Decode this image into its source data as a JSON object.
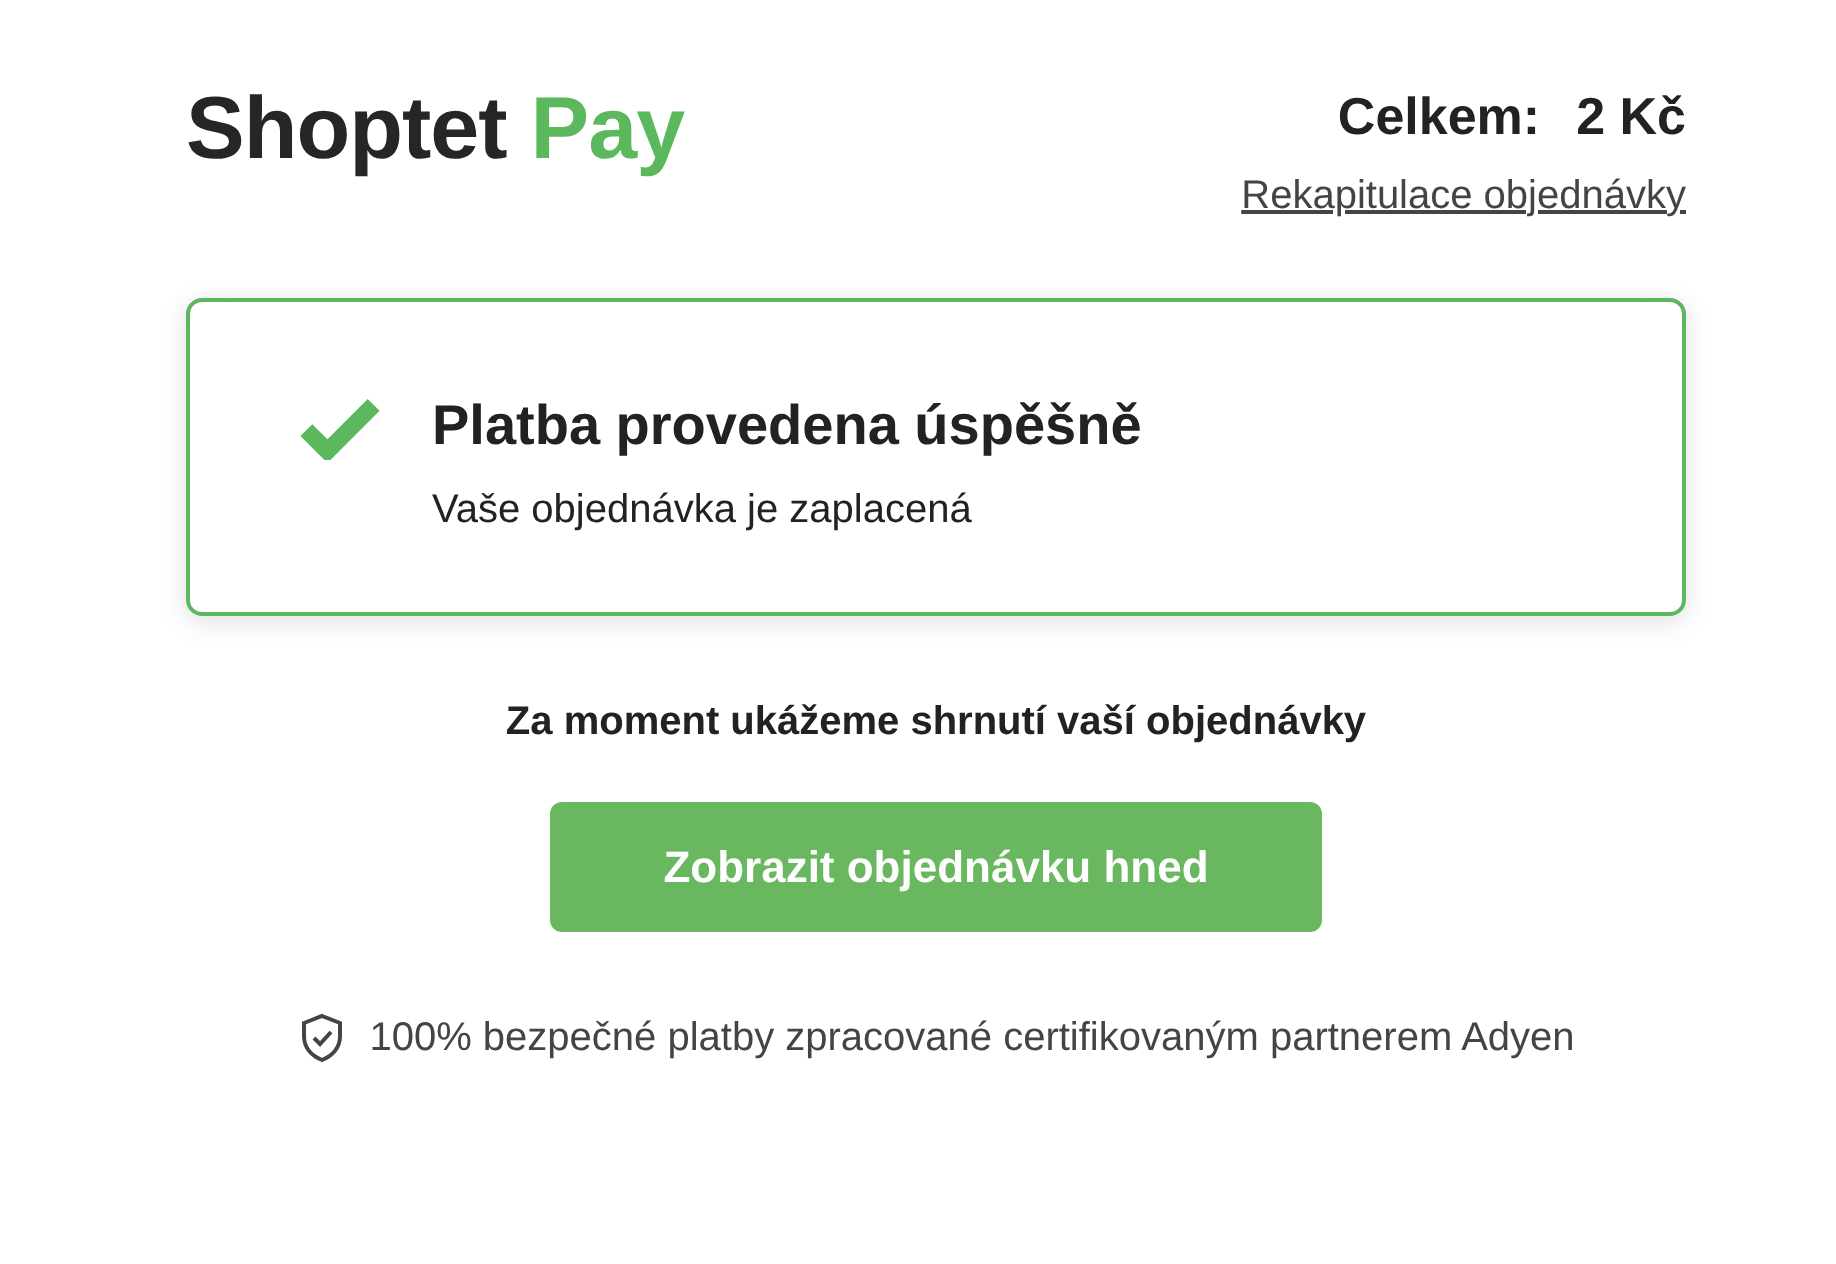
{
  "logo": {
    "name": "Shoptet",
    "accent": "Pay"
  },
  "total": {
    "label": "Celkem:",
    "amount": "2 Kč"
  },
  "summary_link": "Rekapitulace objednávky",
  "status_card": {
    "kind": "success",
    "title": "Platba provedena úspěšně",
    "message": "Vaše objednávka je zaplacená"
  },
  "notice": "Za moment ukážeme shrnutí vaší objednávky",
  "button": "Zobrazit objednávku hned",
  "security_note": "100% bezpečné platby zpracované certifikovaným partnerem Adyen"
}
